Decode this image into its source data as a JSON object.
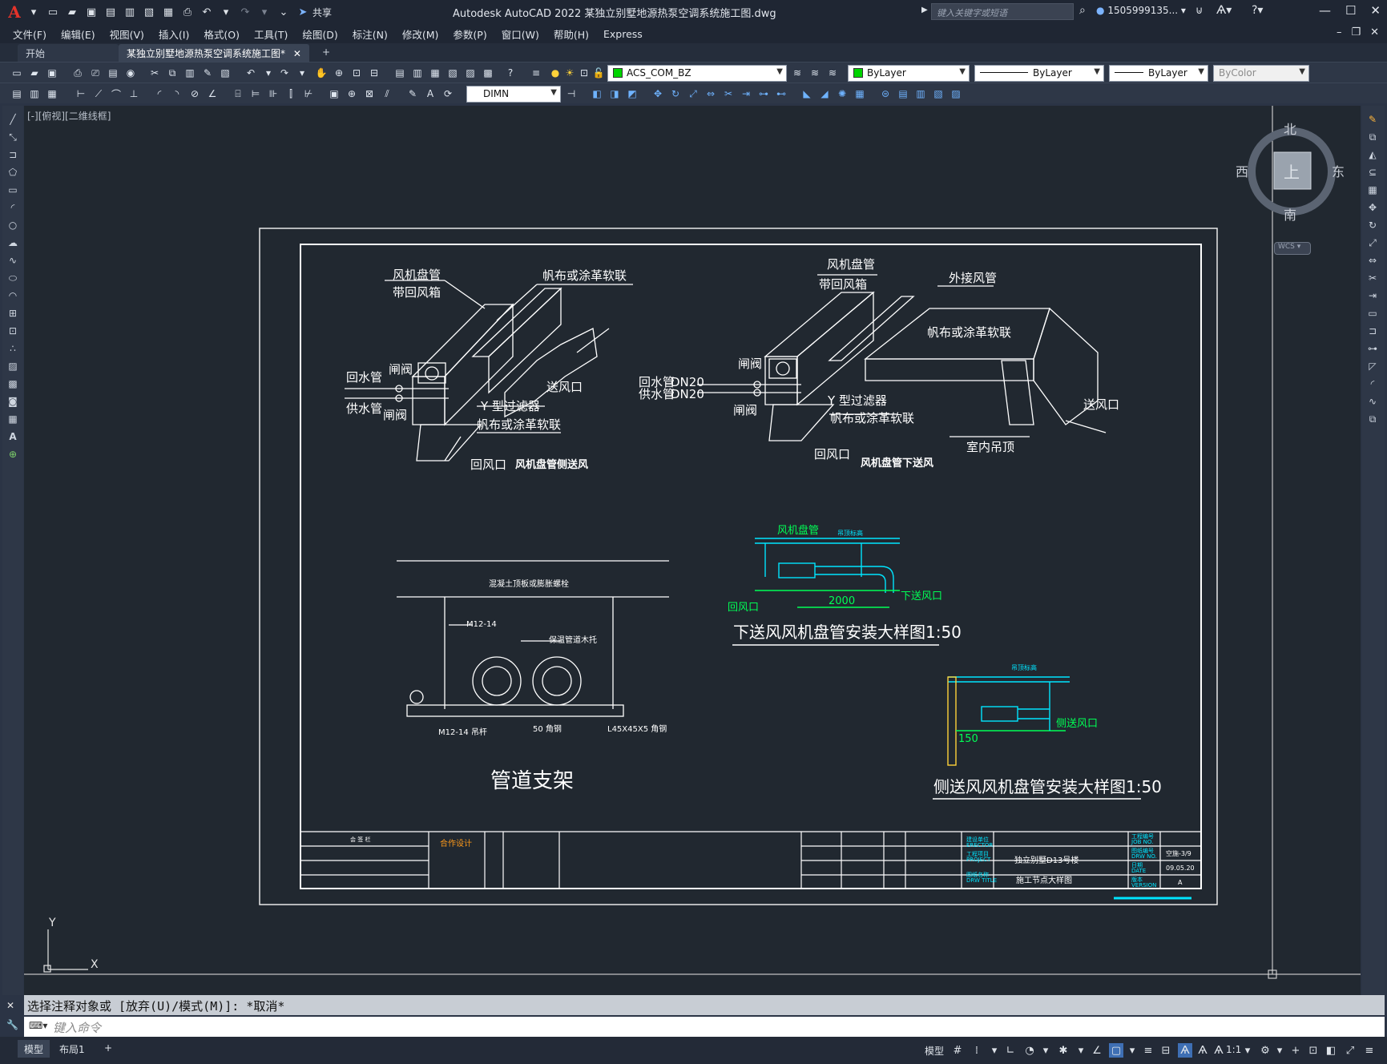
{
  "app": {
    "title": "Autodesk AutoCAD 2022    某独立别墅地源热泵空调系统施工图.dwg",
    "search_placeholder": "键入关键字或短语",
    "user": "1505999135...",
    "share": "共享"
  },
  "menus": [
    "文件(F)",
    "编辑(E)",
    "视图(V)",
    "插入(I)",
    "格式(O)",
    "工具(T)",
    "绘图(D)",
    "标注(N)",
    "修改(M)",
    "参数(P)",
    "窗口(W)",
    "帮助(H)",
    "Express"
  ],
  "tabs": {
    "start": "开始",
    "active": "某独立别墅地源热泵空调系统施工图*",
    "new": "+"
  },
  "properties": {
    "layer": "ACS_COM_BZ",
    "color": "ByLayer",
    "linetype": "ByLayer",
    "lineweight": "ByLayer",
    "plotstyle": "ByColor",
    "dimstyle": "DIMN",
    "layer_color": "#00d400"
  },
  "viewport": {
    "label": "[-][俯视][二维线框]",
    "compass": {
      "north": "北",
      "south": "南",
      "east": "东",
      "west": "西",
      "top": "上",
      "wcs": "WCS"
    },
    "ucs": {
      "x": "X",
      "y": "Y"
    }
  },
  "drawing": {
    "fig1": {
      "labels": [
        "风机盘管",
        "带回风箱",
        "帆布或涂革软联",
        "回水管",
        "闸阀",
        "供水管",
        "闸阀",
        "送风口",
        "Y 型过滤器",
        "帆布或涂革软联",
        "回风口"
      ],
      "caption": "风机盘管侧送风"
    },
    "fig2": {
      "labels": [
        "风机盘管",
        "带回风箱",
        "外接风管",
        "帆布或涂革软联",
        "闸阀",
        "回水管",
        "供水管",
        "DN20",
        "DN20",
        "闸阀",
        "Y 型过滤器",
        "帆布或涂革软联",
        "送风口",
        "室内吊顶",
        "回风口"
      ],
      "caption": "风机盘管下送风"
    },
    "fig3": {
      "title": "管道支架",
      "labels": [
        "混凝土顶板或膨胀螺栓",
        "M12-14",
        "保温管道木托",
        "M12-14 吊杆",
        "50 角钢",
        "L45X45X5 角钢"
      ]
    },
    "fig4": {
      "title": "下送风风机盘管安装大样图1:50",
      "labels": [
        "风机盘管",
        "吊顶标高",
        "回风口",
        "下送风口",
        "2000"
      ]
    },
    "fig5": {
      "title": "侧送风风机盘管安装大样图1:50",
      "labels": [
        "吊顶标高",
        "侧送风口",
        "150"
      ]
    },
    "titleblock": {
      "company_mark": "合作设计",
      "project": "独立别墅D13号楼",
      "drawing_name": "施工节点大样图",
      "sheet_no": "空施-3/9",
      "date": "09.05.20",
      "version": "A",
      "small_labels": [
        "会 签 栏",
        "建设单位",
        "ERECTOR",
        "工程项目",
        "PROJECT",
        "图纸名称",
        "DRW TITLE",
        "工程编号",
        "JOB NO.",
        "图纸编号",
        "DRW NO.",
        "日期",
        "DATE",
        "版本",
        "VERSION"
      ]
    }
  },
  "command": {
    "history": "选择注释对象或 [放弃(U)/模式(M)]: *取消*",
    "placeholder": "键入命令"
  },
  "status": {
    "layouts": [
      "模型",
      "布局1",
      "+"
    ],
    "model_label": "模型",
    "scale": "1:1"
  }
}
